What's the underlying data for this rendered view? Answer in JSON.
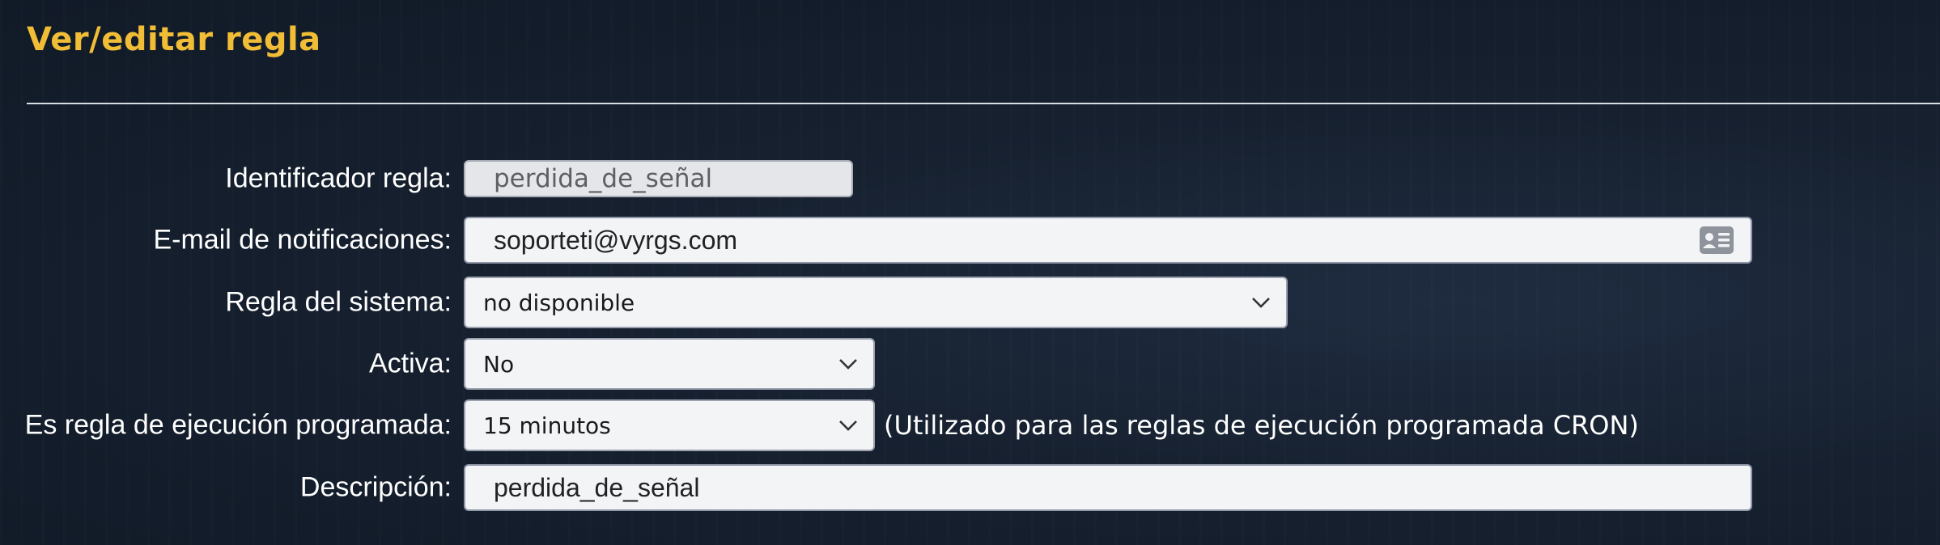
{
  "page": {
    "title": "Ver/editar regla"
  },
  "form": {
    "rule_id": {
      "label": "Identificador regla:",
      "value": "perdida_de_señal"
    },
    "notification_email": {
      "label": "E-mail de notificaciones:",
      "value": "soporteti@vyrgs.com",
      "icon": "contact-card-icon"
    },
    "system_rule": {
      "label": "Regla del sistema:",
      "selected": "no disponible"
    },
    "active": {
      "label": "Activa:",
      "selected": "No"
    },
    "scheduled": {
      "label": "Es regla de ejecución programada:",
      "selected": "15 minutos",
      "note": "(Utilizado para las reglas de ejecución programada CRON)"
    },
    "description": {
      "label": "Descripción:",
      "value": "perdida_de_señal"
    }
  },
  "colors": {
    "title": "#f2bd36",
    "background": "#131c2a",
    "label": "#ffffff"
  }
}
